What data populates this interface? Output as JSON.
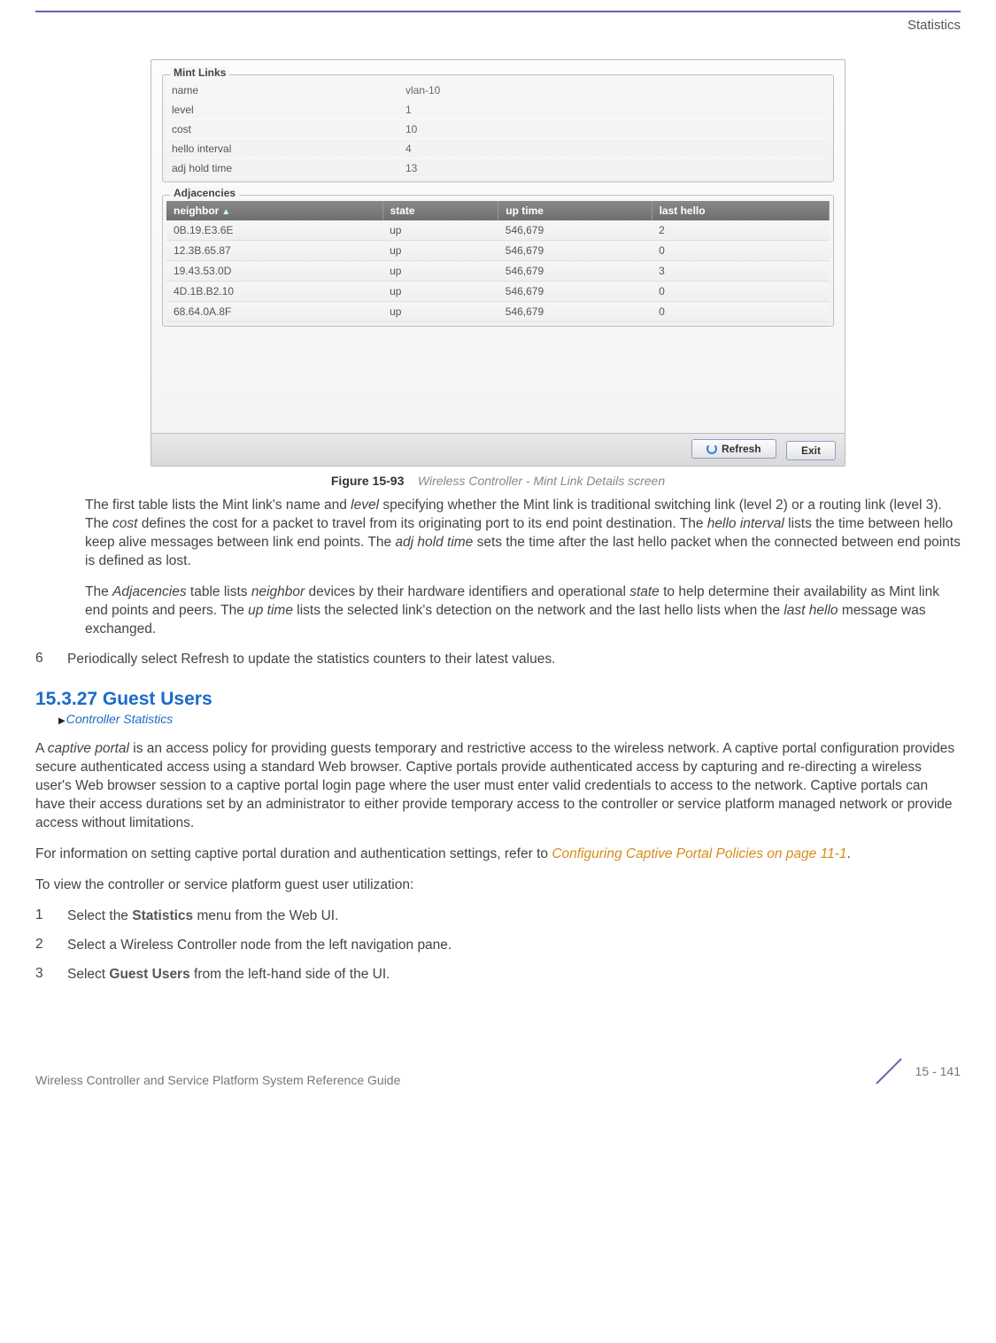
{
  "header": {
    "section_name": "Statistics"
  },
  "screenshot": {
    "mint_links": {
      "legend": "Mint Links",
      "rows": [
        {
          "label": "name",
          "value": "vlan-10"
        },
        {
          "label": "level",
          "value": "1"
        },
        {
          "label": "cost",
          "value": "10"
        },
        {
          "label": "hello interval",
          "value": "4"
        },
        {
          "label": "adj hold time",
          "value": "13"
        }
      ]
    },
    "adjacencies": {
      "legend": "Adjacencies",
      "headers": [
        "neighbor",
        "state",
        "up time",
        "last hello"
      ],
      "rows": [
        {
          "neighbor": "0B.19.E3.6E",
          "state": "up",
          "up_time": "546,679",
          "last_hello": "2"
        },
        {
          "neighbor": "12.3B.65.87",
          "state": "up",
          "up_time": "546,679",
          "last_hello": "0"
        },
        {
          "neighbor": "19.43.53.0D",
          "state": "up",
          "up_time": "546,679",
          "last_hello": "3"
        },
        {
          "neighbor": "4D.1B.B2.10",
          "state": "up",
          "up_time": "546,679",
          "last_hello": "0"
        },
        {
          "neighbor": "68.64.0A.8F",
          "state": "up",
          "up_time": "546,679",
          "last_hello": "0"
        }
      ]
    },
    "buttons": {
      "refresh": "Refresh",
      "exit": "Exit"
    }
  },
  "figure": {
    "label": "Figure 15-93",
    "text": "Wireless Controller - Mint Link Details screen"
  },
  "paragraphs": {
    "p1_a": "The first table lists the Mint link's name and ",
    "p1_level": "level",
    "p1_b": " specifying whether the Mint link is traditional switching link (level 2) or a routing link (level 3). The ",
    "p1_cost": "cost",
    "p1_c": " defines the cost for a packet to travel from its originating port to its end point destination. The ",
    "p1_hello": "hello interval",
    "p1_d": " lists the time between hello keep alive messages between link end points. The ",
    "p1_adj": "adj hold time",
    "p1_e": " sets the time after the last hello packet when the connected between end points is defined as lost.",
    "p2_a": "The ",
    "p2_adj": "Adjacencies",
    "p2_b": " table lists ",
    "p2_neigh": "neighbor",
    "p2_c": " devices by their hardware identifiers and operational ",
    "p2_state": "state",
    "p2_d": " to help determine their availability as Mint link end points and peers. The ",
    "p2_uptime": "up time",
    "p2_e": " lists the selected link's detection on the network and the last hello lists when the ",
    "p2_lasthello": "last hello",
    "p2_f": " message was exchanged.",
    "step6_a": "Periodically select ",
    "step6_refresh": "Refresh",
    "step6_b": " to update the statistics counters to their latest values.",
    "p3": "A ",
    "p3_cp": "captive portal",
    "p3_b": " is an access policy for providing guests temporary and restrictive access to the wireless network. A captive portal configuration provides secure authenticated access using a standard Web browser. Captive portals provide authenticated access by capturing and re-directing a wireless user's Web browser session to a captive portal login page where the user must enter valid credentials to access to the network. Captive portals can have their access durations set by an administrator to either provide temporary access to the controller or service platform managed network or provide access without limitations.",
    "p4_a": "For information on setting captive portal duration and authentication settings, refer to ",
    "p4_link": "Configuring Captive Portal Policies on page 11-1",
    "p4_b": ".",
    "p5": "To view the controller or service platform guest user utilization:",
    "s1_a": "Select the ",
    "s1_stats": "Statistics",
    "s1_b": " menu from the Web UI.",
    "s2": "Select a Wireless Controller node from the left navigation pane.",
    "s3_a": "Select ",
    "s3_gu": "Guest Users",
    "s3_b": " from the left-hand side of the UI."
  },
  "section": {
    "number_title": "15.3.27  Guest Users",
    "breadcrumb": "Controller Statistics"
  },
  "steps": {
    "n6": "6",
    "n1": "1",
    "n2": "2",
    "n3": "3"
  },
  "footer": {
    "guide": "Wireless Controller and Service Platform System Reference Guide",
    "page": "15 - 141"
  }
}
